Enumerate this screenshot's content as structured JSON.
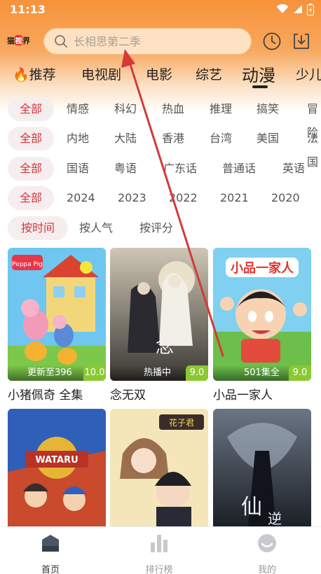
{
  "status_bar": {
    "time": "11:13"
  },
  "header": {
    "logo_left": "猫",
    "logo_mid": "视",
    "logo_right": "界",
    "search_placeholder": "长相思第二季"
  },
  "nav_tabs": [
    {
      "label": "推荐",
      "icon": "flame-icon"
    },
    {
      "label": "电视剧"
    },
    {
      "label": "电影"
    },
    {
      "label": "综艺"
    },
    {
      "label": "动漫",
      "active": true
    },
    {
      "label": "少儿"
    }
  ],
  "filters": {
    "type": [
      "全部",
      "情感",
      "科幻",
      "热血",
      "推理",
      "搞笑",
      "冒险"
    ],
    "region": [
      "全部",
      "内地",
      "大陆",
      "香港",
      "台湾",
      "美国",
      "法国"
    ],
    "language": [
      "全部",
      "国语",
      "粤语",
      "广东话",
      "普通话",
      "英语"
    ],
    "year": [
      "全部",
      "2024",
      "2023",
      "2022",
      "2021",
      "2020"
    ],
    "sort": [
      "按时间",
      "按人气",
      "按评分"
    ]
  },
  "cards": [
    {
      "title": "小猪佩奇 全集",
      "status": "更新至396",
      "score": "10.0"
    },
    {
      "title": "念无双",
      "status": "热播中",
      "score": "9.0"
    },
    {
      "title": "小品一家人",
      "status": "501集全",
      "score": "9.0"
    },
    {
      "title": "",
      "status": "",
      "score": ""
    },
    {
      "title": "",
      "status": "",
      "score": ""
    },
    {
      "title": "",
      "status": "",
      "score": ""
    }
  ],
  "bottom_nav": [
    {
      "label": "首页",
      "icon": "home-icon",
      "active": true
    },
    {
      "label": "排行榜",
      "icon": "ranking-icon"
    },
    {
      "label": "我的",
      "icon": "profile-icon"
    }
  ],
  "colors": {
    "accent": "#d2373f",
    "header_orange": "#f7923a",
    "score_green": "#8bc831",
    "annotation_arrow": "#d43a3a"
  }
}
